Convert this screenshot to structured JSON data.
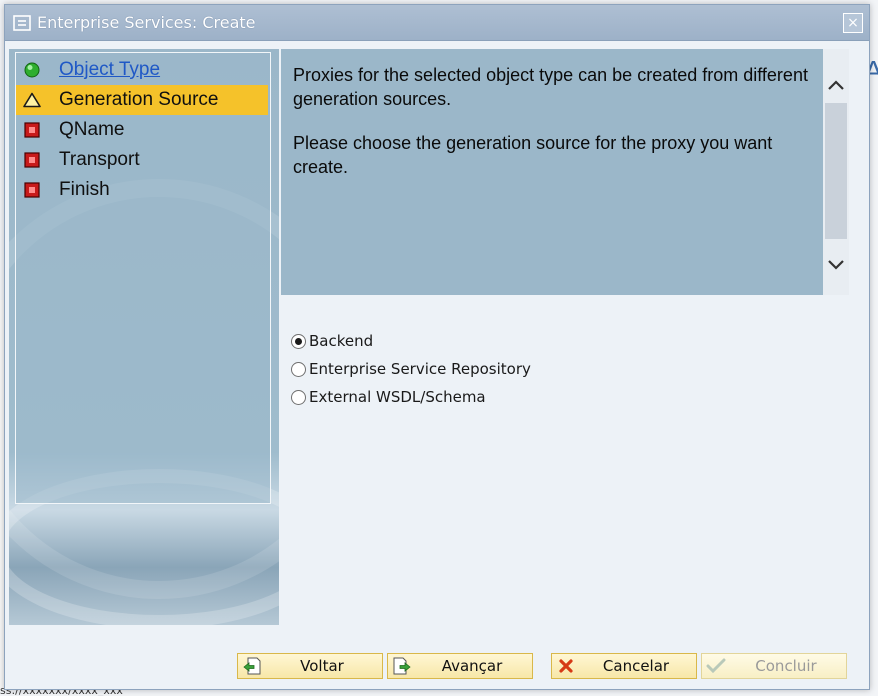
{
  "window": {
    "title": "Enterprise Services: Create",
    "close_symbol": "×"
  },
  "background": {
    "bottom_text": "ss://xxxxxxx/xxxx_xxx",
    "right_letter": "A"
  },
  "nav": {
    "items": [
      {
        "label": "Object Type",
        "status": "completed",
        "icon": "green-circle-icon"
      },
      {
        "label": "Generation Source",
        "status": "current",
        "icon": "warning-triangle-icon"
      },
      {
        "label": "QName",
        "status": "pending",
        "icon": "red-square-icon"
      },
      {
        "label": "Transport",
        "status": "pending",
        "icon": "red-square-icon"
      },
      {
        "label": "Finish",
        "status": "pending",
        "icon": "red-square-icon"
      }
    ]
  },
  "info": {
    "paragraph1": "Proxies for the selected object type can be created from different generation sources.",
    "paragraph2": "Please choose the generation source for the proxy you want create."
  },
  "options": {
    "items": [
      {
        "label": "Backend",
        "selected": true
      },
      {
        "label": "Enterprise Service Repository",
        "selected": false
      },
      {
        "label": "External WSDL/Schema",
        "selected": false
      }
    ]
  },
  "buttons": {
    "back": "Voltar",
    "next": "Avançar",
    "cancel": "Cancelar",
    "finish": "Concluir"
  },
  "colors": {
    "accent_current": "#f5c22a",
    "panel": "#9bb7c9",
    "link": "#1f58c6"
  }
}
